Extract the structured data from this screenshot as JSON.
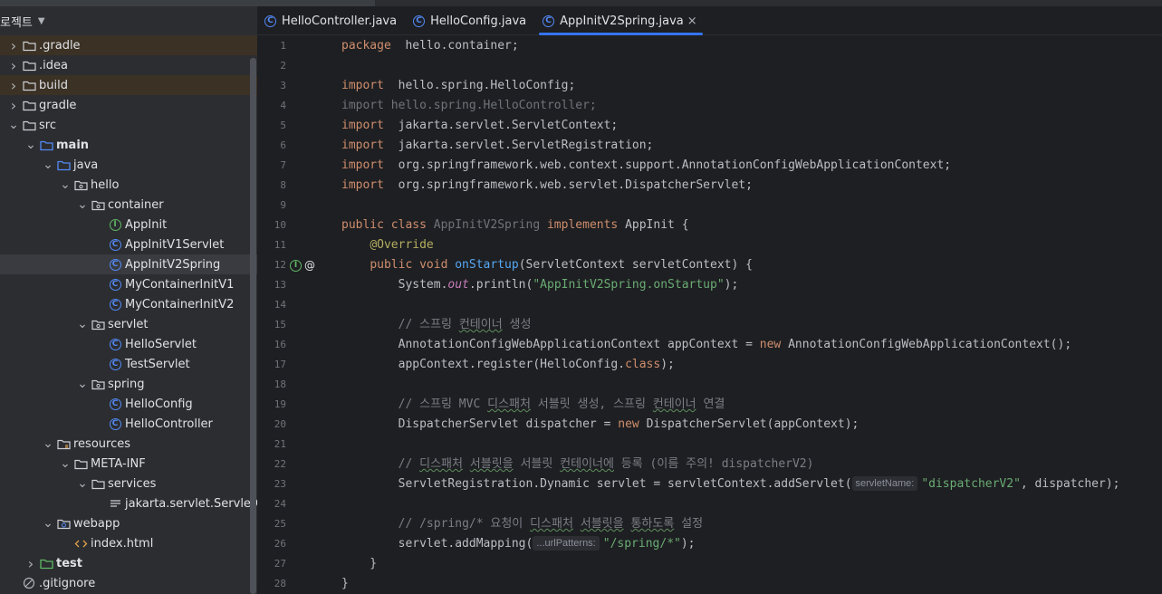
{
  "project": {
    "title": "로젝트",
    "tree": [
      {
        "label": ".gradle",
        "indent": 0,
        "arrow": "right",
        "icon": "folder-icon",
        "highlight": "orange"
      },
      {
        "label": ".idea",
        "indent": 0,
        "arrow": "right",
        "icon": "folder-icon"
      },
      {
        "label": "build",
        "indent": 0,
        "arrow": "right",
        "icon": "folder-icon",
        "highlight": "orange"
      },
      {
        "label": "gradle",
        "indent": 0,
        "arrow": "right",
        "icon": "folder-icon"
      },
      {
        "label": "src",
        "indent": 0,
        "arrow": "down",
        "icon": "folder-icon"
      },
      {
        "label": "main",
        "indent": 1,
        "arrow": "down",
        "icon": "source-folder-icon",
        "bold": true
      },
      {
        "label": "java",
        "indent": 2,
        "arrow": "down",
        "icon": "source-folder-icon"
      },
      {
        "label": "hello",
        "indent": 3,
        "arrow": "down",
        "icon": "package-icon"
      },
      {
        "label": "container",
        "indent": 4,
        "arrow": "down",
        "icon": "package-icon"
      },
      {
        "label": "AppInit",
        "indent": 5,
        "arrow": "none",
        "icon": "interface-icon"
      },
      {
        "label": "AppInitV1Servlet",
        "indent": 5,
        "arrow": "none",
        "icon": "class-icon"
      },
      {
        "label": "AppInitV2Spring",
        "indent": 5,
        "arrow": "none",
        "icon": "class-icon",
        "selected": true
      },
      {
        "label": "MyContainerInitV1",
        "indent": 5,
        "arrow": "none",
        "icon": "class-icon"
      },
      {
        "label": "MyContainerInitV2",
        "indent": 5,
        "arrow": "none",
        "icon": "class-icon"
      },
      {
        "label": "servlet",
        "indent": 4,
        "arrow": "down",
        "icon": "package-icon"
      },
      {
        "label": "HelloServlet",
        "indent": 5,
        "arrow": "none",
        "icon": "class-icon"
      },
      {
        "label": "TestServlet",
        "indent": 5,
        "arrow": "none",
        "icon": "class-icon"
      },
      {
        "label": "spring",
        "indent": 4,
        "arrow": "down",
        "icon": "package-icon"
      },
      {
        "label": "HelloConfig",
        "indent": 5,
        "arrow": "none",
        "icon": "class-icon"
      },
      {
        "label": "HelloController",
        "indent": 5,
        "arrow": "none",
        "icon": "class-icon"
      },
      {
        "label": "resources",
        "indent": 2,
        "arrow": "down",
        "icon": "resources-folder-icon"
      },
      {
        "label": "META-INF",
        "indent": 3,
        "arrow": "down",
        "icon": "folder-icon"
      },
      {
        "label": "services",
        "indent": 4,
        "arrow": "down",
        "icon": "folder-icon"
      },
      {
        "label": "jakarta.servlet.ServletContainerInitializer",
        "indent": 5,
        "arrow": "none",
        "icon": "text-file-icon"
      },
      {
        "label": "webapp",
        "indent": 2,
        "arrow": "down",
        "icon": "web-folder-icon"
      },
      {
        "label": "index.html",
        "indent": 3,
        "arrow": "none",
        "icon": "html-file-icon"
      },
      {
        "label": "test",
        "indent": 1,
        "arrow": "right",
        "icon": "test-folder-icon",
        "bold": true
      },
      {
        "label": ".gitignore",
        "indent": 0,
        "arrow": "none",
        "icon": "ignore-file-icon"
      }
    ]
  },
  "tabs": [
    {
      "label": "HelloController.java",
      "active": false
    },
    {
      "label": "HelloConfig.java",
      "active": false
    },
    {
      "label": "AppInitV2Spring.java",
      "active": true,
      "close": "×"
    }
  ],
  "editor": {
    "line_numbers": [
      "1",
      "2",
      "3",
      "4",
      "5",
      "6",
      "7",
      "8",
      "9",
      "10",
      "11",
      "12",
      "13",
      "14",
      "15",
      "16",
      "17",
      "18",
      "19",
      "20",
      "21",
      "22",
      "23",
      "24",
      "25",
      "26",
      "27",
      "28"
    ],
    "lines": [
      [
        [
          "kw",
          "package"
        ],
        [
          "",
          "  hello.container;"
        ]
      ],
      [],
      [
        [
          "kw",
          "import"
        ],
        [
          "",
          "  hello.spring.HelloConfig;"
        ]
      ],
      [
        [
          "dim",
          "import hello.spring.HelloController;"
        ]
      ],
      [
        [
          "kw",
          "import"
        ],
        [
          "",
          "  jakarta.servlet.ServletContext;"
        ]
      ],
      [
        [
          "kw",
          "import"
        ],
        [
          "",
          "  jakarta.servlet.ServletRegistration;"
        ]
      ],
      [
        [
          "kw",
          "import"
        ],
        [
          "",
          "  org.springframework.web.context.support.AnnotationConfigWebApplicationContext;"
        ]
      ],
      [
        [
          "kw",
          "import"
        ],
        [
          "",
          "  org.springframework.web.servlet.DispatcherServlet;"
        ]
      ],
      [],
      [
        [
          "kw",
          "public class "
        ],
        [
          "dim",
          "AppInitV2Spring"
        ],
        [
          "kw",
          " implements "
        ],
        [
          "",
          "AppInit {"
        ]
      ],
      [
        [
          "",
          "    "
        ],
        [
          "ann",
          "@Override"
        ]
      ],
      [
        [
          "",
          "    "
        ],
        [
          "kw",
          "public void "
        ],
        [
          "fn",
          "onStartup"
        ],
        [
          "",
          "(ServletContext servletContext) {"
        ]
      ],
      [
        [
          "",
          "        System."
        ],
        [
          "it",
          "out"
        ],
        [
          "",
          ".println("
        ],
        [
          "str",
          "\"AppInitV2Spring.onStartup\""
        ],
        [
          "",
          ");"
        ]
      ],
      [],
      [
        [
          "",
          "        "
        ],
        [
          "cm",
          "// 스프링 "
        ],
        [
          "cmsq",
          "컨테이너"
        ],
        [
          "cm",
          " 생성"
        ]
      ],
      [
        [
          "",
          "        AnnotationConfigWebApplicationContext appContext = "
        ],
        [
          "kw",
          "new "
        ],
        [
          "",
          "AnnotationConfigWebApplicationContext();"
        ]
      ],
      [
        [
          "",
          "        appContext.register(HelloConfig."
        ],
        [
          "kw",
          "class"
        ],
        [
          "",
          ");"
        ]
      ],
      [],
      [
        [
          "",
          "        "
        ],
        [
          "cm",
          "// 스프링 MVC "
        ],
        [
          "cmsq",
          "디스패처"
        ],
        [
          "cm",
          " 서블릿 생성, 스프링 "
        ],
        [
          "cmsq",
          "컨테이너"
        ],
        [
          "cm",
          " 연결"
        ]
      ],
      [
        [
          "",
          "        DispatcherServlet dispatcher = "
        ],
        [
          "kw",
          "new "
        ],
        [
          "",
          "DispatcherServlet(appContext);"
        ]
      ],
      [],
      [
        [
          "",
          "        "
        ],
        [
          "cm",
          "// "
        ],
        [
          "cmsq",
          "디스패처"
        ],
        [
          "cm",
          " "
        ],
        [
          "cmsq",
          "서블릿을"
        ],
        [
          "cm",
          " 서블릿 "
        ],
        [
          "cmsq",
          "컨테이너에"
        ],
        [
          "cm",
          " 등록 (이름 주의! dispatcherV2)"
        ]
      ],
      [
        [
          "",
          "        ServletRegistration.Dynamic servlet = servletContext.addServlet("
        ],
        [
          "hint",
          "servletName:"
        ],
        [
          "str",
          "\"dispatcherV2\""
        ],
        [
          "",
          ", dispatcher);"
        ]
      ],
      [],
      [
        [
          "",
          "        "
        ],
        [
          "cm",
          "// /spring/* 요청이 "
        ],
        [
          "cmsq",
          "디스패처"
        ],
        [
          "cm",
          " "
        ],
        [
          "cmsq",
          "서블릿을"
        ],
        [
          "cm",
          " "
        ],
        [
          "cmsq",
          "통하도록"
        ],
        [
          "cm",
          " 설정"
        ]
      ],
      [
        [
          "",
          "        servlet.addMapping("
        ],
        [
          "hint",
          "...urlPatterns:"
        ],
        [
          "str",
          "\"/spring/*\""
        ],
        [
          "",
          ");"
        ]
      ],
      [
        [
          "",
          "    }"
        ]
      ],
      [
        [
          "",
          "}"
        ]
      ]
    ],
    "gutter_icons": [
      "implement-method-icon",
      "annotation-at-icon"
    ]
  }
}
